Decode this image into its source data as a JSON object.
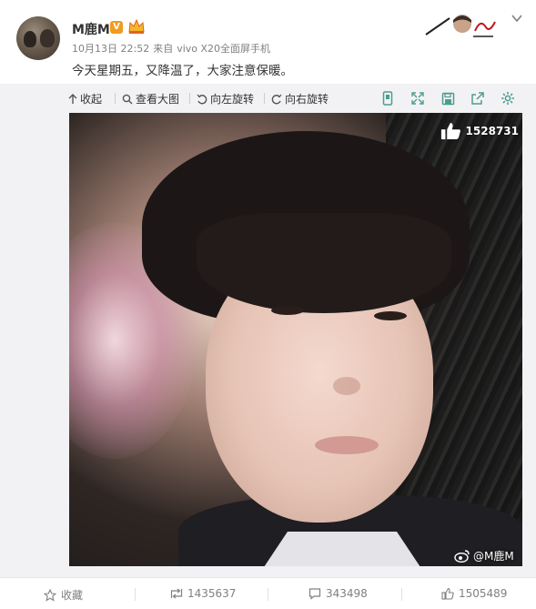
{
  "post": {
    "username": "M鹿M",
    "verified_badge": "V",
    "date": "10月13日 22:52",
    "source_prefix": "来自",
    "source": "vivo X20全面屏手机",
    "text": "今天星期五，又降温了，大家注意保暖。"
  },
  "toolbar": {
    "collapse_label": "收起",
    "view_large_label": "查看大图",
    "rotate_left_label": "向左旋转",
    "rotate_right_label": "向右旋转",
    "icons": [
      "phone-icon",
      "fullscreen-icon",
      "save-icon",
      "share-icon",
      "settings-icon"
    ]
  },
  "photo": {
    "like_count": "1528731",
    "watermark": "@M鹿M"
  },
  "actions": {
    "favorite_label": "收藏",
    "repost_count": "1435637",
    "comment_count": "343498",
    "like_count": "1505489"
  },
  "colors": {
    "accent_orange": "#f19b1f",
    "toolbar_bg": "#f2f2f5",
    "icon_green": "#4c9d8f",
    "meta_gray": "#808080"
  }
}
